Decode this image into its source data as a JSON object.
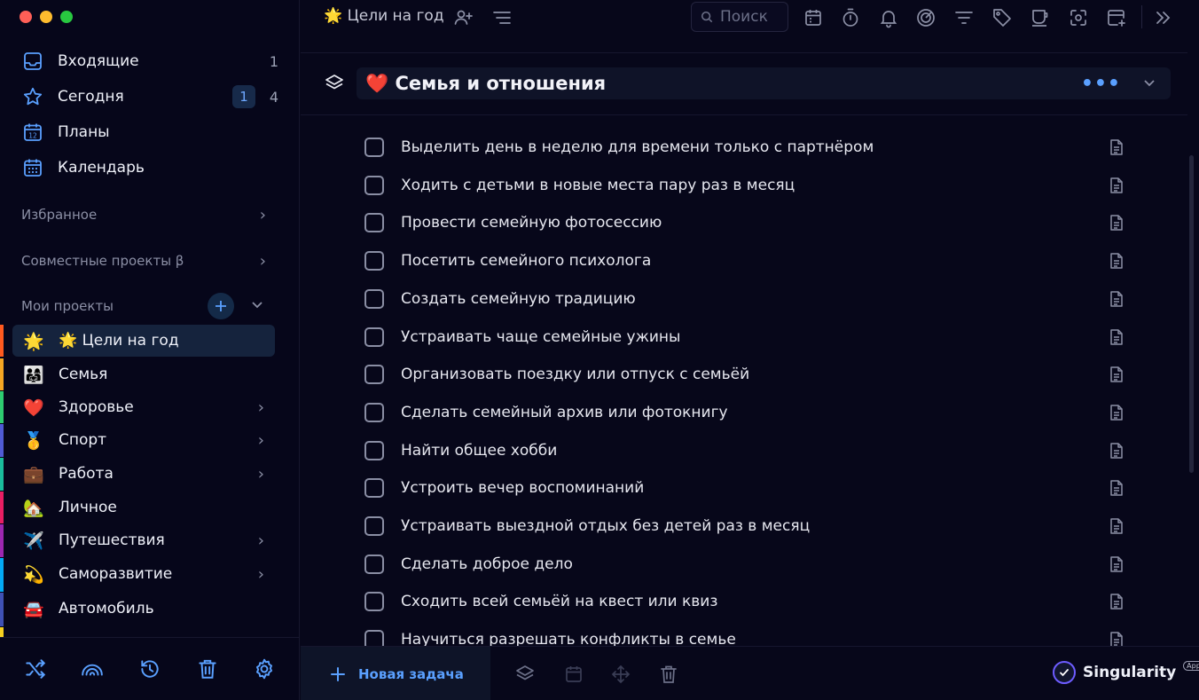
{
  "sidebar": {
    "nav": [
      {
        "label": "Входящие",
        "count": "1",
        "icon": "inbox-icon"
      },
      {
        "label": "Сегодня",
        "badge": "1",
        "count": "4",
        "icon": "star-icon"
      },
      {
        "label": "Планы",
        "icon": "plans-calendar-icon",
        "icon_text": "12"
      },
      {
        "label": "Календарь",
        "icon": "calendar-grid-icon"
      }
    ],
    "sections": {
      "favorites": "Избранное",
      "shared": "Совместные проекты β",
      "my_projects": "Мои проекты"
    },
    "projects": [
      {
        "emoji": "🌟",
        "label": "🌟 Цели на год",
        "active": true,
        "stripe": "#ff5a1f"
      },
      {
        "emoji": "👨‍👩‍👧",
        "label": "Семья",
        "stripe": "#f5a623"
      },
      {
        "emoji": "❤️",
        "label": "Здоровье",
        "has_children": true,
        "stripe": "#2ecc71"
      },
      {
        "emoji": "🥇",
        "label": "Спорт",
        "has_children": true,
        "stripe": "#4f5bd5"
      },
      {
        "emoji": "💼",
        "label": "Работа",
        "has_children": true,
        "stripe": "#1abc9c"
      },
      {
        "emoji": "🏡",
        "label": "Личное",
        "stripe": "#e91e63"
      },
      {
        "emoji": "✈️",
        "label": "Путешествия",
        "has_children": true,
        "stripe": "#9c27b0"
      },
      {
        "emoji": "💫",
        "label": "Саморазвитие",
        "has_children": true,
        "stripe": "#03a9f4"
      },
      {
        "emoji": "🚘",
        "label": "Автомобиль",
        "stripe": "#3f51b5"
      }
    ]
  },
  "topbar": {
    "title": "🌟 Цели на год",
    "search_placeholder": "Поиск"
  },
  "group": {
    "title": "❤️ Семья и отношения",
    "more": "•••"
  },
  "tasks": [
    "Выделить день в неделю для времени только с партнёром",
    "Ходить с детьми в новые места пару раз в месяц",
    "Провести семейную фотосессию",
    "Посетить семейного психолога",
    "Создать семейную традицию",
    "Устраивать чаще семейные ужины",
    "Организовать поездку или отпуск с семьёй",
    "Сделать семейный архив или фотокнигу",
    "Найти общее хобби",
    "Устроить вечер воспоминаний",
    "Устраивать выездной отдых без детей раз в месяц",
    "Сделать доброе дело",
    "Сходить всей семьёй на квест или квиз",
    "Научиться разрешать конфликты в семье"
  ],
  "bottombar": {
    "new_task": "Новая задача",
    "brand": "Singularity",
    "brand_tag": "App"
  },
  "colors": {
    "accent": "#5aa0ff",
    "background": "#07071a",
    "active_project": "#15233d"
  }
}
